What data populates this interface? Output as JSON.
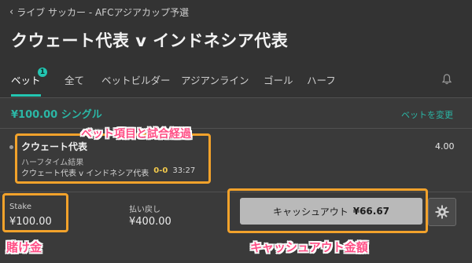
{
  "header": {
    "breadcrumb": "ライブ サッカー - AFCアジアカップ予選",
    "title": "クウェート代表 v インドネシア代表"
  },
  "tabs": [
    {
      "label": "ベット",
      "active": true
    },
    {
      "label": "全て"
    },
    {
      "label": "ベットビルダー"
    },
    {
      "label": "アジアンライン"
    },
    {
      "label": "ゴール"
    },
    {
      "label": "ハーフ"
    }
  ],
  "bet_badge": "1",
  "bet": {
    "summary": "¥100.00 シングル",
    "change_link": "ベットを変更",
    "selection": "クウェート代表",
    "market": "ハーフタイム結果",
    "match": "クウェート代表 v インドネシア代表",
    "score": "0-0",
    "time": "33:27",
    "odds": "4.00"
  },
  "stake": {
    "label": "Stake",
    "value": "¥100.00"
  },
  "payout": {
    "label": "払い戻し",
    "value": "¥400.00"
  },
  "cashout": {
    "label": "キャッシュアウト",
    "amount": "¥66.67"
  },
  "annotations": {
    "bet_item": "ベット項目と試合経過",
    "stake": "賭け金",
    "cashout_amount": "キャッシュアウト金額"
  },
  "colors": {
    "accent": "#23c6b2",
    "highlight": "#f2a22b",
    "annotation": "#ff4f86",
    "score": "#f2c94c"
  },
  "icons": [
    "chevron-left-icon",
    "bell-icon",
    "gear-icon"
  ]
}
